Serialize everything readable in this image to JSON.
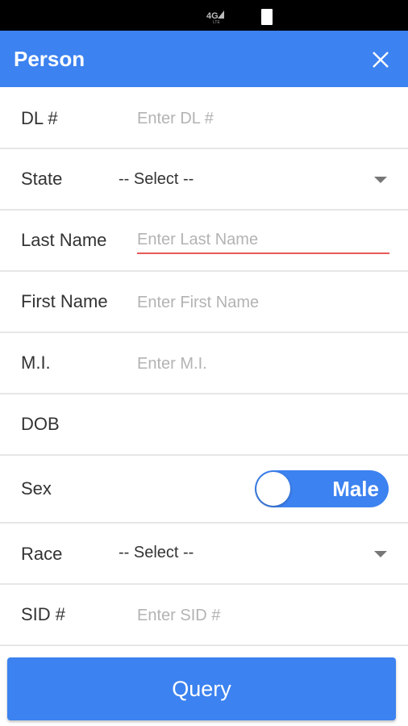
{
  "header": {
    "title": "Person",
    "close_icon": "close-icon"
  },
  "status_bar": {
    "network": "4G"
  },
  "form": {
    "dl": {
      "label": "DL #",
      "placeholder": "Enter DL #",
      "value": ""
    },
    "state": {
      "label": "State",
      "selected": "-- Select --"
    },
    "last_name": {
      "label": "Last Name",
      "placeholder": "Enter Last Name",
      "value": ""
    },
    "first_name": {
      "label": "First Name",
      "placeholder": "Enter First Name",
      "value": ""
    },
    "mi": {
      "label": "M.I.",
      "placeholder": "Enter M.I.",
      "value": ""
    },
    "dob": {
      "label": "DOB"
    },
    "sex": {
      "label": "Sex",
      "toggle_text": "Male"
    },
    "race": {
      "label": "Race",
      "selected": "-- Select --"
    },
    "sid": {
      "label": "SID #",
      "placeholder": "Enter SID #",
      "value": ""
    }
  },
  "actions": {
    "query_label": "Query"
  },
  "colors": {
    "accent": "#3c82f0",
    "error_underline": "#e85a5a"
  }
}
